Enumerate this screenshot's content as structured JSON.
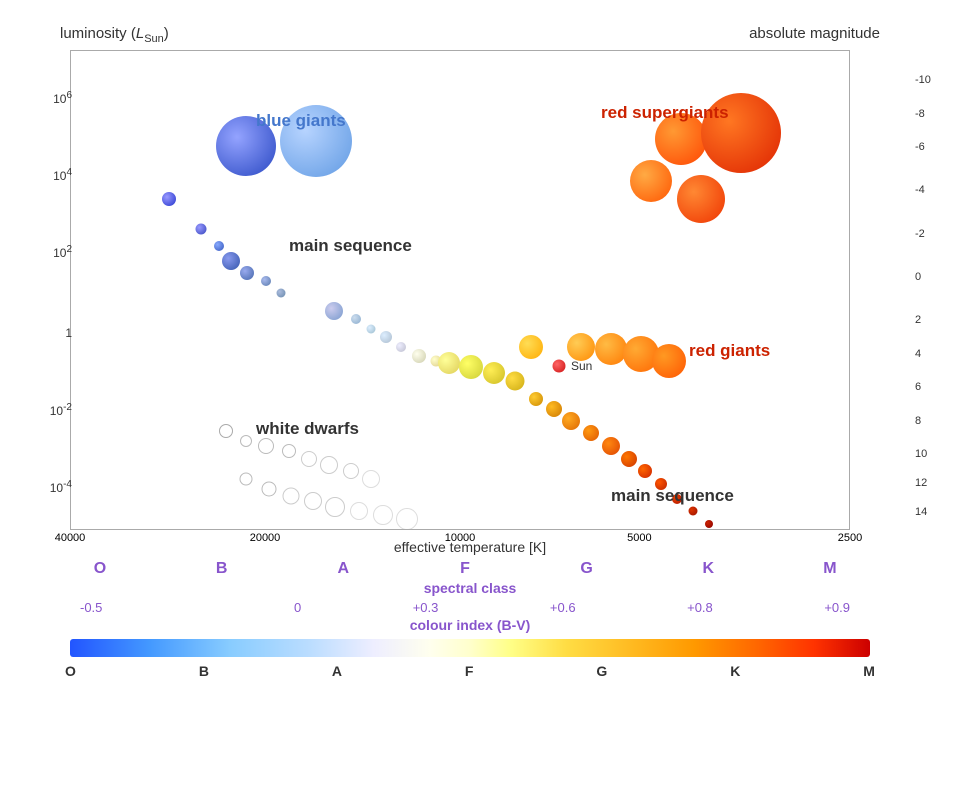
{
  "chart": {
    "title_left": "luminosity (L",
    "title_left_sub": "Sun",
    "title_left_suffix": ")",
    "title_right": "absolute magnitude",
    "x_axis_label": "effective temperature [K]",
    "x_ticks": [
      "40000",
      "20000",
      "10000",
      "5000",
      "2500"
    ],
    "y_ticks_left": [
      "10⁶",
      "10⁴",
      "10²",
      "1",
      "10⁻²",
      "10⁻⁴"
    ],
    "y_ticks_right": [
      "-10",
      "-8",
      "-6",
      "-4",
      "-2",
      "0",
      "2",
      "4",
      "6",
      "8",
      "10",
      "12",
      "14"
    ],
    "regions": {
      "blue_giants": "blue giants",
      "red_supergiants": "red supergiants",
      "main_sequence_top": "main sequence",
      "white_dwarfs": "white dwarfs",
      "red_giants": "red giants",
      "main_sequence_bottom": "main sequence",
      "sun": "Sun"
    }
  },
  "spectral": {
    "title": "spectral class",
    "letters": [
      "O",
      "B",
      "A",
      "F",
      "G",
      "K",
      "M"
    ],
    "color_index_title": "colour index (B-V)",
    "color_index_values": [
      "-0.5",
      "0",
      "+0.3",
      "+0.6",
      "+0.8",
      "+0.9"
    ],
    "bar_letters": [
      "O",
      "B",
      "A",
      "F",
      "G",
      "K",
      "M"
    ]
  }
}
